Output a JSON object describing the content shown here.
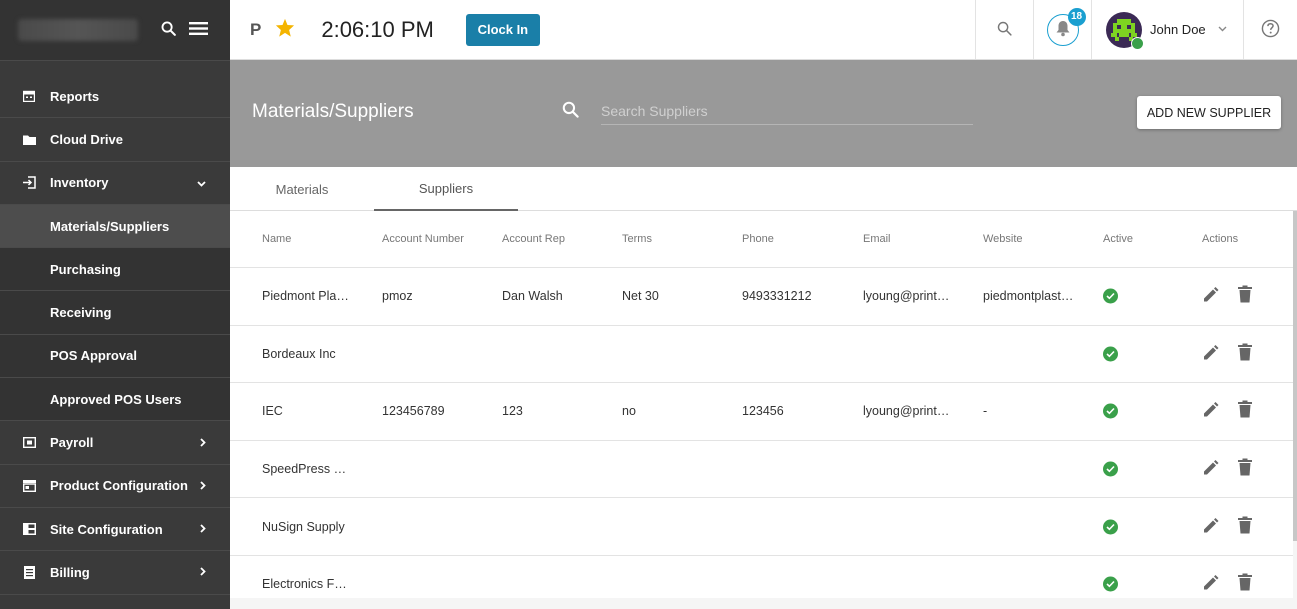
{
  "sidebar": {
    "items": [
      {
        "label": "Reports",
        "icon": "calendar-icon"
      },
      {
        "label": "Cloud Drive",
        "icon": "folder-icon"
      },
      {
        "label": "Inventory",
        "icon": "login-icon"
      },
      {
        "label": "Materials/Suppliers"
      },
      {
        "label": "Purchasing"
      },
      {
        "label": "Receiving"
      },
      {
        "label": "POS Approval"
      },
      {
        "label": "Approved POS Users"
      },
      {
        "label": "Payroll",
        "icon": "payroll-icon"
      },
      {
        "label": "Product Configuration",
        "icon": "store-icon"
      },
      {
        "label": "Site Configuration",
        "icon": "grid-icon"
      },
      {
        "label": "Billing",
        "icon": "list-icon"
      }
    ]
  },
  "topbar": {
    "p_label": "P",
    "time": "2:06:10 PM",
    "clock_in": "Clock In",
    "notif_count": "18",
    "user_name": "John Doe"
  },
  "header": {
    "title": "Materials/Suppliers",
    "search_placeholder": "Search Suppliers",
    "add_button": "ADD NEW SUPPLIER"
  },
  "tabs": [
    "Materials",
    "Suppliers"
  ],
  "table": {
    "columns": [
      "Name",
      "Account Number",
      "Account Rep",
      "Terms",
      "Phone",
      "Email",
      "Website",
      "Active",
      "Actions"
    ],
    "rows": [
      {
        "name": "Piedmont Pla…",
        "acct": "pmoz",
        "rep": "Dan Walsh",
        "terms": "Net 30",
        "phone": "9493331212",
        "email": "lyoung@print…",
        "web": "piedmontplast…",
        "active": true
      },
      {
        "name": "Bordeaux Inc",
        "acct": "",
        "rep": "",
        "terms": "",
        "phone": "",
        "email": "",
        "web": "",
        "active": true
      },
      {
        "name": "IEC",
        "acct": "123456789",
        "rep": "123",
        "terms": "no",
        "phone": "123456",
        "email": "lyoung@print…",
        "web": "-",
        "active": true
      },
      {
        "name": "SpeedPress Si…",
        "acct": "",
        "rep": "",
        "terms": "",
        "phone": "",
        "email": "",
        "web": "",
        "active": true
      },
      {
        "name": "NuSign Supply",
        "acct": "",
        "rep": "",
        "terms": "",
        "phone": "",
        "email": "",
        "web": "",
        "active": true
      },
      {
        "name": "Electronics Fo…",
        "acct": "",
        "rep": "",
        "terms": "",
        "phone": "",
        "email": "",
        "web": "",
        "active": true
      }
    ]
  }
}
